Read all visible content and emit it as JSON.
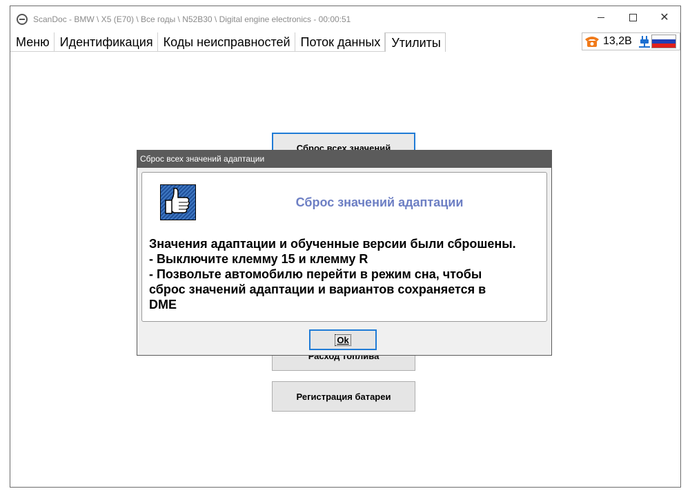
{
  "window": {
    "title": "ScanDoc - BMW \\ X5 (E70) \\ Все годы \\ N52B30 \\ Digital engine electronics - 00:00:51"
  },
  "tabs": [
    {
      "label": "Меню"
    },
    {
      "label": "Идентификация"
    },
    {
      "label": "Коды неисправностей"
    },
    {
      "label": "Поток данных"
    },
    {
      "label": "Утилиты",
      "active": true
    }
  ],
  "status": {
    "voltage": "13,2B",
    "icons": [
      "phone-icon",
      "plug-icon",
      "russian-flag-icon"
    ]
  },
  "utilities": {
    "buttons": [
      {
        "label": "Сброс всех значений"
      },
      {
        "label": "Расход топлива"
      },
      {
        "label": "Регистрация батареи"
      }
    ]
  },
  "dialog": {
    "title": "Сброс всех значений адаптации",
    "heading": "Сброс значений адаптации",
    "message_lines": [
      "Значения адаптации и обученные версии были сброшены.",
      "- Выключите клемму 15 и клемму R",
      "- Позвольте автомобилю перейти в режим сна, чтобы",
      "сброс значений адаптации и вариантов сохраняется в",
      "DME"
    ],
    "ok_label": "Ok",
    "icon": "thumbs-up-icon"
  },
  "colors": {
    "heading": "#6d7fc4",
    "dialog_titlebar": "#5b5b5b",
    "focus_border": "#1f7bd6"
  }
}
